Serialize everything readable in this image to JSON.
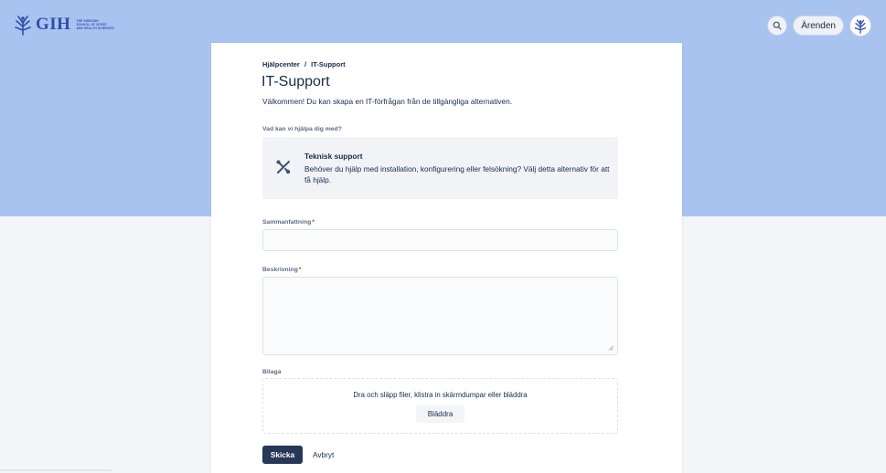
{
  "header": {
    "logo_text": "GIH",
    "logo_subtext": [
      "THE SWEDISH",
      "SCHOOL OF SPORT",
      "AND HEALTH SCIENCES"
    ],
    "search_icon": "search-icon",
    "requests_label": "Ärenden",
    "avatar_icon": "gih-tree-icon"
  },
  "breadcrumb": {
    "home": "Hjälpcenter",
    "separator": "/",
    "current": "IT-Support"
  },
  "page": {
    "title": "IT-Support",
    "welcome": "Välkommen! Du kan skapa en IT-förfrågan från de tillgängliga alternativen."
  },
  "request_type": {
    "question": "Vad kan vi hjälpa dig med?",
    "icon": "tools-icon",
    "title": "Teknisk support",
    "description": "Behöver du hjälp med installation, konfigurering eller felsökning? Välj detta alternativ för att få hjälp."
  },
  "form": {
    "summary_label": "Sammanfattning",
    "summary_value": "",
    "description_label": "Beskrivning",
    "description_value": "",
    "required_marker": "*",
    "attachment_label": "Bilaga",
    "drop_text": "Dra och släpp filer, klistra in skärmdumpar eller bläddra",
    "browse_label": "Bläddra",
    "submit_label": "Skicka",
    "cancel_label": "Avbryt"
  },
  "colors": {
    "banner": "#a9c3f1",
    "primary_button": "#253858",
    "brand": "#2f4fa8",
    "required": "#de350b"
  }
}
